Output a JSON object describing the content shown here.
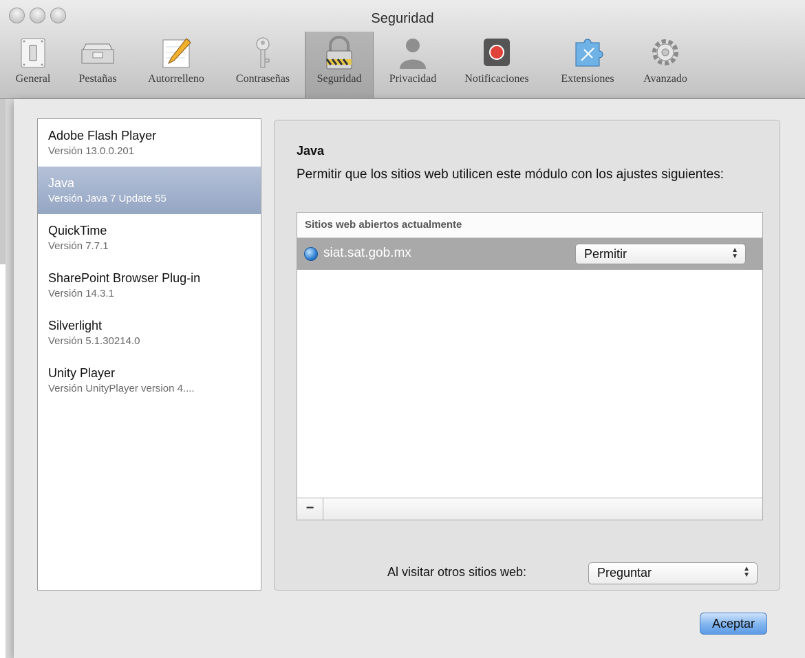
{
  "window": {
    "title": "Seguridad"
  },
  "toolbar": {
    "items": [
      {
        "label": "General",
        "icon": "general-switch-icon"
      },
      {
        "label": "Pestañas",
        "icon": "tabs-icon"
      },
      {
        "label": "Autorrelleno",
        "icon": "autofill-pencil-icon"
      },
      {
        "label": "Contraseñas",
        "icon": "key-icon"
      },
      {
        "label": "Seguridad",
        "icon": "padlock-icon",
        "selected": true
      },
      {
        "label": "Privacidad",
        "icon": "person-silhouette-icon"
      },
      {
        "label": "Notificaciones",
        "icon": "notification-record-icon"
      },
      {
        "label": "Extensiones",
        "icon": "puzzle-extension-icon"
      },
      {
        "label": "Avanzado",
        "icon": "gear-icon"
      }
    ]
  },
  "plugins": [
    {
      "name": "Adobe Flash Player",
      "version": "Versión 13.0.0.201"
    },
    {
      "name": "Java",
      "version": "Versión Java 7 Update 55",
      "selected": true
    },
    {
      "name": "QuickTime",
      "version": "Versión 7.7.1"
    },
    {
      "name": "SharePoint Browser Plug-in",
      "version": "Versión 14.3.1"
    },
    {
      "name": "Silverlight",
      "version": "Versión 5.1.30214.0"
    },
    {
      "name": "Unity Player",
      "version": "Versión UnityPlayer version 4...."
    }
  ],
  "settings": {
    "title": "Java",
    "description": "Permitir que los sitios web utilicen este módulo con los ajustes siguientes:",
    "table_header": "Sitios web abiertos actualmente",
    "sites": [
      {
        "site": "siat.sat.gob.mx",
        "setting": "Permitir"
      }
    ],
    "remove_label": "−",
    "other_sites_label": "Al visitar otros sitios web:",
    "other_sites_value": "Preguntar"
  },
  "buttons": {
    "accept": "Aceptar"
  },
  "colors": {
    "accent": "#6aa6ea",
    "selection": "#a5b5d0"
  }
}
